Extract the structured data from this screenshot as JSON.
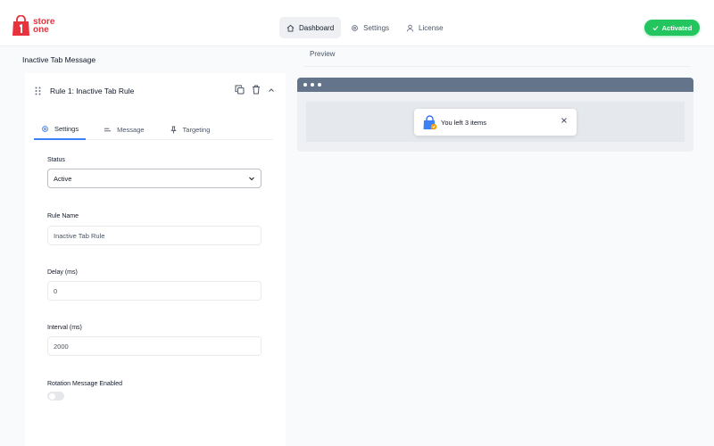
{
  "brand": {
    "line1": "store",
    "line2": "one",
    "color": "#e8323c"
  },
  "nav": {
    "items": [
      {
        "label": "Dashboard",
        "icon": "home-icon",
        "active": true
      },
      {
        "label": "Settings",
        "icon": "gear-icon",
        "active": false
      },
      {
        "label": "License",
        "icon": "user-icon",
        "active": false
      }
    ]
  },
  "status_pill": {
    "label": "Activated",
    "color": "#22c55e"
  },
  "page": {
    "title": "Inactive Tab Message"
  },
  "rule": {
    "title": "Rule 1: Inactive Tab Rule",
    "tabs": [
      {
        "label": "Settings",
        "icon": "gear-icon",
        "active": true
      },
      {
        "label": "Message",
        "icon": "lines-icon",
        "active": false
      },
      {
        "label": "Targeting",
        "icon": "pin-icon",
        "active": false
      }
    ],
    "fields": {
      "status": {
        "label": "Status",
        "value": "Active"
      },
      "rule_name": {
        "label": "Rule Name",
        "value": "Inactive Tab Rule"
      },
      "delay": {
        "label": "Delay (ms)",
        "value": "0"
      },
      "interval": {
        "label": "Interval (ms)",
        "value": "2000"
      },
      "rotation": {
        "label": "Rotation Message Enabled",
        "enabled": false
      }
    }
  },
  "preview": {
    "label": "Preview",
    "toast_text": "You left 3 items",
    "toast_icon": "shopping-bag-icon"
  }
}
